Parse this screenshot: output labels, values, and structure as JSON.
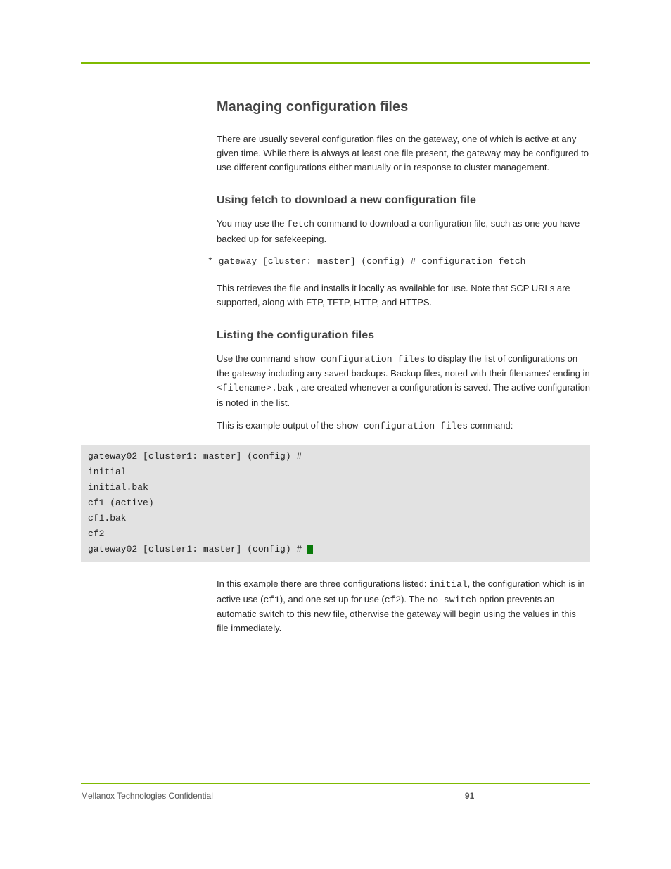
{
  "section_title": "Managing configuration files",
  "intro": "There are usually several configuration files on the gateway, one of which is active at any given time. While there is always at least one file present, the gateway may be configured to use different configurations either manually or in response to cluster management.",
  "fetch": {
    "heading": "Using fetch to download a new configuration file",
    "p1a": "You may use the ",
    "p1_code": "fetch",
    "p1b": " command to download a configuration file, such as one you have backed up for safekeeping.",
    "code": "* gateway [cluster: master] (config) # configuration fetch",
    "p2": "This retrieves the file and installs it locally as available for use. Note that SCP URLs are supported, along with FTP, TFTP, HTTP, and HTTPS."
  },
  "list": {
    "heading": "Listing the configuration files",
    "p1a": "Use the command ",
    "p1_code": "show configuration files",
    "p1b": " to display the list of configurations on the gateway including any saved backups. Backup files, noted with their filenames' ending in ",
    "p1_code2": "<filename>.bak",
    "p1c": " , are created whenever a configuration is saved. The active configuration is noted in the list.",
    "p2a": "This is example output of the ",
    "p2_code": "show configuration files",
    "p2b": " command:",
    "cli_prompt": "gateway02 [cluster1: master] (config) # ",
    "cli_lines": [
      "initial",
      "initial.bak",
      "cf1 (active)",
      "cf1.bak",
      "cf2"
    ],
    "p3a": "In this example there are three configurations listed:  ",
    "p3_code1": "initial",
    "p3b": " in active use (",
    "p3_code2": "cf1",
    "p3c": "), and one set up for use (",
    "p3_code3": "cf2",
    "p3d": "). The  ",
    "p3_code4": "no-switch",
    "p3e": " option prevents an automatic switch to this new file, otherwise the gateway will begin using the values in this file immediately.",
    "p3_mid": ",  the configuration which is "
  },
  "footer": {
    "left": "Mellanox Technologies Confidential",
    "page": "91"
  }
}
